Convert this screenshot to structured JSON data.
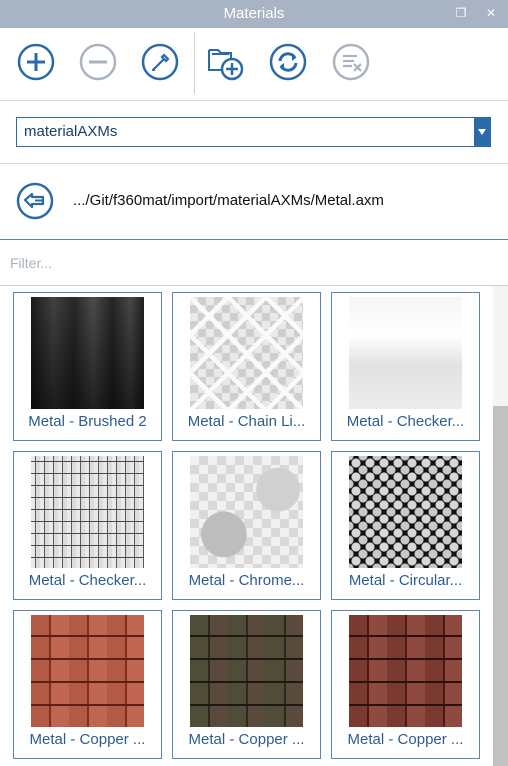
{
  "window": {
    "title": "Materials"
  },
  "toolbar": {
    "buttons": [
      {
        "icon": "plus-circle-icon"
      },
      {
        "icon": "minus-circle-icon"
      },
      {
        "icon": "eyedropper-icon"
      },
      {
        "icon": "add-library-folder-icon"
      },
      {
        "icon": "refresh-icon"
      },
      {
        "icon": "remove-library-icon"
      }
    ]
  },
  "library": {
    "selected": "materialAXMs"
  },
  "path": {
    "text": ".../Git/f360mat/import/materialAXMs/Metal.axm"
  },
  "filter": {
    "placeholder": "Filter...",
    "value": ""
  },
  "materials": [
    {
      "label": "Metal - Brushed 2"
    },
    {
      "label": "Metal - Chain Li..."
    },
    {
      "label": "Metal - Checker..."
    },
    {
      "label": "Metal - Checker..."
    },
    {
      "label": "Metal - Chrome..."
    },
    {
      "label": "Metal - Circular..."
    },
    {
      "label": "Metal - Copper ..."
    },
    {
      "label": "Metal - Copper ..."
    },
    {
      "label": "Metal - Copper ..."
    }
  ],
  "colors": {
    "accent": "#2b6aa8",
    "titlebar": "#a8b4c4",
    "label": "#2c5d8f"
  }
}
